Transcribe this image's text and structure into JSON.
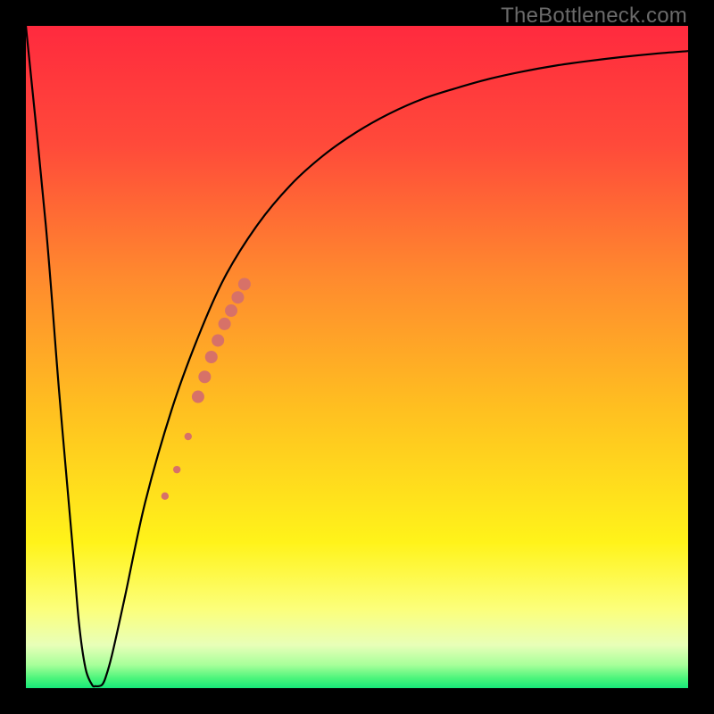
{
  "watermark": "TheBottleneck.com",
  "chart_data": {
    "type": "line",
    "title": "",
    "xlabel": "",
    "ylabel": "",
    "xlim": [
      0,
      100
    ],
    "ylim": [
      0,
      100
    ],
    "background_gradient": {
      "stops": [
        {
          "offset": 0.0,
          "color": "#ff2a3e"
        },
        {
          "offset": 0.18,
          "color": "#ff4a3a"
        },
        {
          "offset": 0.38,
          "color": "#ff8a2e"
        },
        {
          "offset": 0.58,
          "color": "#ffc020"
        },
        {
          "offset": 0.78,
          "color": "#fff31a"
        },
        {
          "offset": 0.88,
          "color": "#fcff7a"
        },
        {
          "offset": 0.935,
          "color": "#e8ffb8"
        },
        {
          "offset": 0.965,
          "color": "#a7ff9a"
        },
        {
          "offset": 0.985,
          "color": "#4cf57b"
        },
        {
          "offset": 1.0,
          "color": "#17e879"
        }
      ]
    },
    "series": [
      {
        "name": "bottleneck-curve",
        "x": [
          0,
          3,
          5,
          7,
          8,
          9,
          10,
          10.5,
          11,
          11.5,
          12,
          13,
          15,
          18,
          22,
          26,
          30,
          35,
          40,
          45,
          50,
          55,
          60,
          65,
          70,
          75,
          80,
          85,
          90,
          95,
          100
        ],
        "y": [
          100,
          70,
          45,
          22,
          10,
          3,
          0.5,
          0.3,
          0.3,
          0.5,
          1.5,
          5,
          14,
          28,
          42,
          53,
          62,
          70,
          76,
          80.5,
          84,
          86.8,
          89,
          90.6,
          92,
          93.1,
          94,
          94.7,
          95.3,
          95.8,
          96.2
        ]
      }
    ],
    "markers": {
      "name": "highlight-dots",
      "color": "#d77168",
      "points": [
        {
          "x": 21.0,
          "y": 29.0,
          "r": 4.2
        },
        {
          "x": 22.8,
          "y": 33.0,
          "r": 4.2
        },
        {
          "x": 24.5,
          "y": 38.0,
          "r": 4.2
        },
        {
          "x": 26.0,
          "y": 44.0,
          "r": 7.0
        },
        {
          "x": 27.0,
          "y": 47.0,
          "r": 7.0
        },
        {
          "x": 28.0,
          "y": 50.0,
          "r": 7.0
        },
        {
          "x": 29.0,
          "y": 52.5,
          "r": 7.0
        },
        {
          "x": 30.0,
          "y": 55.0,
          "r": 7.0
        },
        {
          "x": 31.0,
          "y": 57.0,
          "r": 7.0
        },
        {
          "x": 32.0,
          "y": 59.0,
          "r": 7.0
        },
        {
          "x": 33.0,
          "y": 61.0,
          "r": 7.0
        }
      ]
    }
  }
}
